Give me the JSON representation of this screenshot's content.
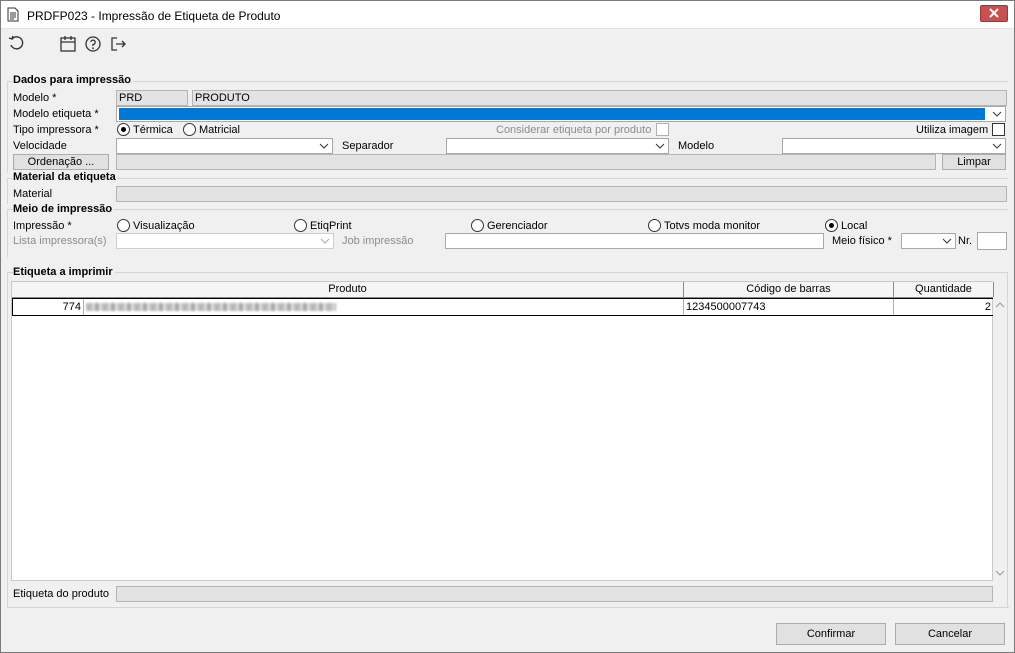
{
  "window": {
    "title": "PRDFP023 - Impressão de Etiqueta de Produto"
  },
  "toolbar": {
    "icons": [
      "refresh-icon",
      "calendar-icon",
      "help-icon",
      "exit-icon"
    ]
  },
  "dados": {
    "group_title": "Dados para impressão",
    "modelo_label": "Modelo *",
    "modelo_code": "PRD",
    "modelo_desc": "PRODUTO",
    "modelo_etiqueta_label": "Modelo etiqueta *",
    "modelo_etiqueta_value": "",
    "tipo_impressora_label": "Tipo impressora *",
    "termica_label": "Térmica",
    "matricial_label": "Matricial",
    "tipo_selected": "Térmica",
    "considerar_label": "Considerar etiqueta por produto",
    "utiliza_imagem_label": "Utiliza imagem",
    "velocidade_label": "Velocidade",
    "separador_label": "Separador",
    "modelo2_label": "Modelo",
    "ordenacao_label": "Ordenação ...",
    "limpar_label": "Limpar"
  },
  "material": {
    "group_title": "Material da etiqueta",
    "material_label": "Material",
    "material_value": ""
  },
  "meio": {
    "group_title": "Meio de impressão",
    "impressao_label": "Impressão *",
    "options": [
      "Visualização",
      "EtiqPrint",
      "Gerenciador",
      "Totvs moda monitor",
      "Local"
    ],
    "selected": "Local",
    "lista_label": "Lista impressora(s)",
    "job_label": "Job impressão",
    "meio_fisico_label": "Meio físico *",
    "nr_label": "Nr."
  },
  "etiqueta": {
    "group_title": "Etiqueta a imprimir",
    "columns": [
      "Produto",
      "Código de barras",
      "Quantidade"
    ],
    "rows": [
      {
        "code": "774",
        "barcode": "1234500007743",
        "qty": "2"
      }
    ],
    "etiqueta_produto_label": "Etiqueta do produto"
  },
  "footer": {
    "confirmar_label": "Confirmar",
    "cancelar_label": "Cancelar"
  }
}
